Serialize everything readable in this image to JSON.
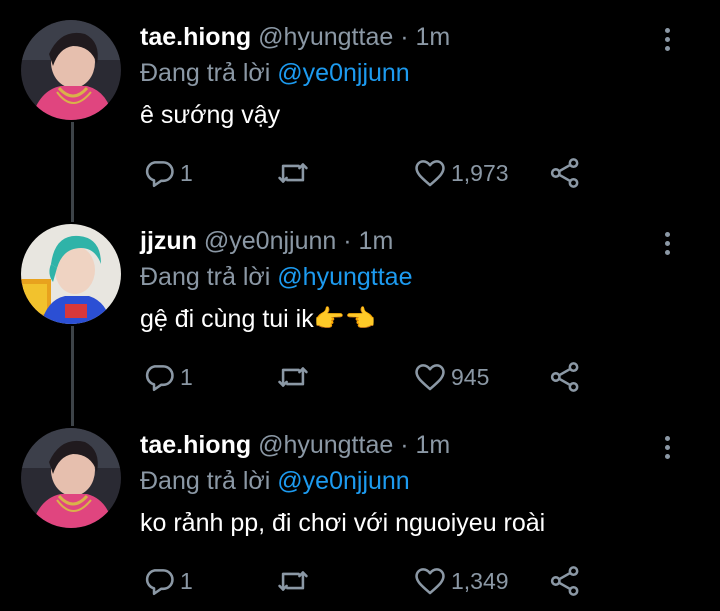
{
  "tweets": [
    {
      "name": "tae.hiong",
      "handle": "@hyungttae",
      "dot": "·",
      "time": "1m",
      "reply_prefix": "Đang trả lời",
      "reply_to": "@ye0njjunn",
      "text": "ê sướng vậy",
      "replies": "1",
      "likes": "1,973",
      "avatar": "avatar-pink-shirt"
    },
    {
      "name": "jjzun",
      "handle": "@ye0njjunn",
      "dot": "·",
      "time": "1m",
      "reply_prefix": "Đang trả lời",
      "reply_to": "@hyungttae",
      "text": "gệ đi cùng tui ik👉👈",
      "replies": "1",
      "likes": "945",
      "avatar": "avatar-blue-hair"
    },
    {
      "name": "tae.hiong",
      "handle": "@hyungttae",
      "dot": "·",
      "time": "1m",
      "reply_prefix": "Đang trả lời",
      "reply_to": "@ye0njjunn",
      "text": "ko rảnh pp, đi chơi với nguoiyeu roài",
      "replies": "1",
      "likes": "1,349",
      "avatar": "avatar-pink-shirt"
    }
  ],
  "icons": {
    "reply": "reply-icon",
    "retweet": "retweet-icon",
    "like": "heart-icon",
    "share": "share-icon",
    "more": "more-vertical-icon"
  },
  "colors": {
    "background": "#000000",
    "name": "#ffffff",
    "secondary": "#8b98a5",
    "mention": "#1d9bf0",
    "thread_line": "#3d4348"
  }
}
